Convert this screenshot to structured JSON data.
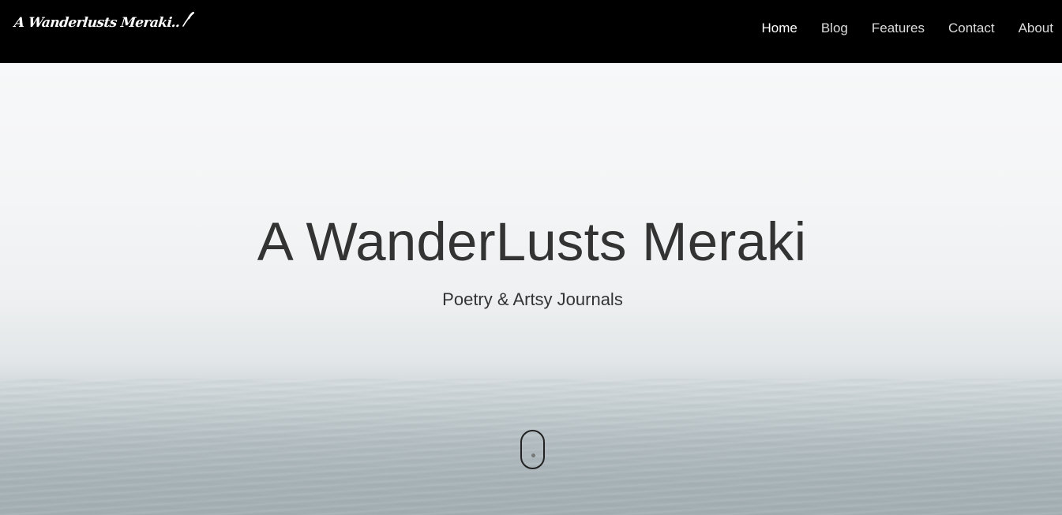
{
  "brand": {
    "logo_text": "A Wanderlusts Meraki",
    "logo_suffix": "..",
    "logo_icon": "quill-icon"
  },
  "nav": {
    "items": [
      {
        "label": "Home",
        "active": true
      },
      {
        "label": "Blog",
        "active": false
      },
      {
        "label": "Features",
        "active": false
      },
      {
        "label": "Contact",
        "active": false
      },
      {
        "label": "About",
        "active": false
      }
    ]
  },
  "hero": {
    "title": "A WanderLusts Meraki",
    "subtitle": "Poetry & Artsy Journals",
    "scroll_indicator": "scroll-mouse-icon"
  },
  "colors": {
    "navbar_bg": "#000000",
    "nav_text": "#dcdcdc",
    "nav_active": "#ffffff",
    "hero_text": "#333333"
  }
}
